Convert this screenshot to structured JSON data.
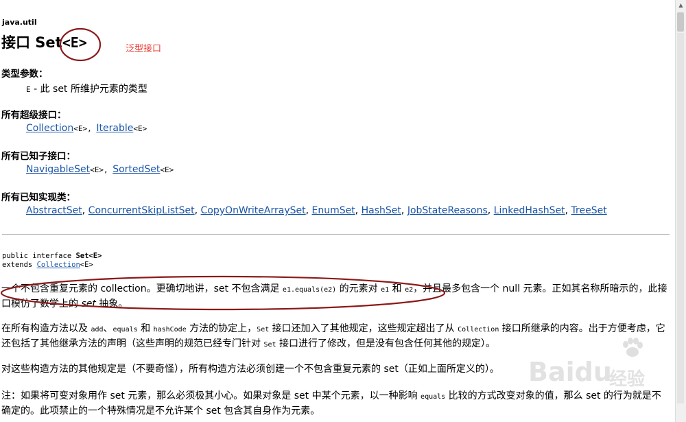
{
  "header": {
    "package": "java.util",
    "title_prefix": "接口 Set",
    "title_generic": "<E>",
    "annotation_label": "泛型接口"
  },
  "type_params": {
    "heading": "类型参数：",
    "param": "E",
    "desc": " - 此 set 所维护元素的类型"
  },
  "super_interfaces": {
    "heading": "所有超级接口：",
    "items": [
      {
        "name": "Collection",
        "suffix": "<E>, "
      },
      {
        "name": "Iterable",
        "suffix": "<E>"
      }
    ]
  },
  "sub_interfaces": {
    "heading": "所有已知子接口：",
    "items": [
      {
        "name": "NavigableSet",
        "suffix": "<E>, "
      },
      {
        "name": "SortedSet",
        "suffix": "<E>"
      }
    ]
  },
  "impl_classes": {
    "heading": "所有已知实现类：",
    "items": [
      "AbstractSet",
      "ConcurrentSkipListSet",
      "CopyOnWriteArraySet",
      "EnumSet",
      "HashSet",
      "JobStateReasons",
      "LinkedHashSet",
      "TreeSet"
    ],
    "separator": ", "
  },
  "declaration": {
    "line1_prefix": "public interface ",
    "line1_name": "Set<E>",
    "line2_prefix": "extends ",
    "line2_link": "Collection",
    "line2_suffix": "<E>"
  },
  "description": {
    "p1_a": "一个不包含重复元素的 collection。更确切地讲，set 不包含满足 ",
    "p1_code1": "e1.equals(e2)",
    "p1_b": " 的元素对 ",
    "p1_code2": "e1",
    "p1_c": " 和 ",
    "p1_code3": "e2",
    "p1_d": "，并且最多包含一个 null 元素。正如其名称所暗示的，此接口模仿了数学上的 ",
    "p1_italic": "set",
    "p1_e": " 抽象。",
    "p2_a": "在所有构造方法以及 ",
    "p2_code1": "add",
    "p2_b": "、",
    "p2_code2": "equals",
    "p2_c": " 和 ",
    "p2_code3": "hashCode",
    "p2_d": " 方法的协定上，",
    "p2_code4": "Set",
    "p2_e": " 接口还加入了其他规定，这些规定超出了从 ",
    "p2_code5": "Collection",
    "p2_f": " 接口所继承的内容。出于方便考虑，它还包括了其他继承方法的声明（这些声明的规范已经专门针对 ",
    "p2_code6": "Set",
    "p2_g": " 接口进行了修改，但是没有包含任何其他的规定）。",
    "p3": "对这些构造方法的其他规定是（不要奇怪），所有构造方法必须创建一个不包含重复元素的 set（正如上面所定义的）。",
    "p4_a": "注：如果将可变对象用作 set 元素，那么必须极其小心。如果对象是 set 中某个元素，以一种影响 ",
    "p4_code1": "equals",
    "p4_b": " 比较的方式改变对象的值，那么 set 的行为就是不确定的。此项禁止的一个特殊情况是不允许某个 set 包含其自身作为元素。"
  },
  "watermark": {
    "brand": "Bai",
    "brand_mid": "du",
    "sub": "经验"
  },
  "colors": {
    "link": "#1a55a8",
    "annotation_text": "#e8362e",
    "annotation_ring": "#8b1a1a"
  }
}
